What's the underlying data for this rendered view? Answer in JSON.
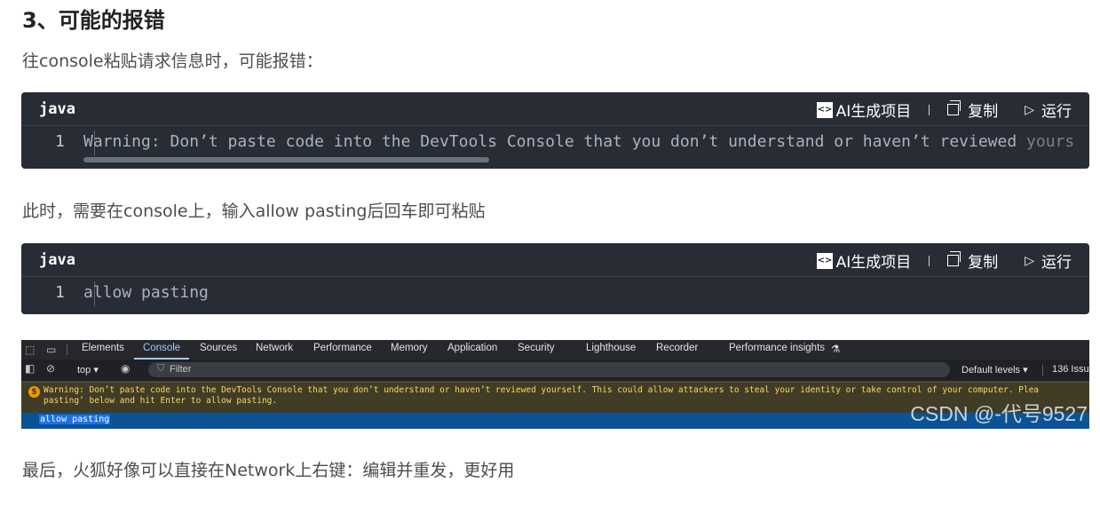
{
  "heading": "3、可能的报错",
  "para1": "往console粘贴请求信息时，可能报错：",
  "para2": "此时，需要在console上，输入allow pasting后回车即可粘贴",
  "para3": "最后，火狐好像可以直接在Network上右键：编辑并重发，更好用",
  "code_blocks": [
    {
      "language": "java",
      "ai_label": "AI生成项目",
      "copy_label": "复制",
      "run_label": "运行",
      "line_number": "1",
      "code_prefix": "Warning",
      "code_colon": ":",
      "code_rest": " Don’t paste code into the DevTools Console that you don’t understand or haven’t reviewed ",
      "code_fade": "yourself"
    },
    {
      "language": "java",
      "ai_label": "AI生成项目",
      "copy_label": "复制",
      "run_label": "运行",
      "line_number": "1",
      "code": "allow pasting"
    }
  ],
  "devtools": {
    "tabs": [
      "Elements",
      "Console",
      "Sources",
      "Network",
      "Performance",
      "Memory",
      "Application",
      "Security",
      "Lighthouse",
      "Recorder",
      "Performance insights"
    ],
    "active_tab": "Console",
    "context": "top ▾",
    "filter_placeholder": "Filter",
    "levels": "Default levels ▾",
    "issues": "136 Issu",
    "warn_count": "5",
    "warning_line1": "Warning: Don’t paste code into the DevTools Console that you don’t understand or haven’t reviewed yourself. This could allow attackers to steal your identity or take control of your computer. Plea",
    "warning_line2": "pasting’ below and hit Enter to allow pasting.",
    "input": "allow pasting",
    "watermark": "CSDN @-代号9527"
  },
  "colors": {
    "code_bg": "#282c34",
    "devtools_bg": "#202124",
    "warning_bg": "#413c26",
    "active_tab": "#a8c7fa"
  }
}
